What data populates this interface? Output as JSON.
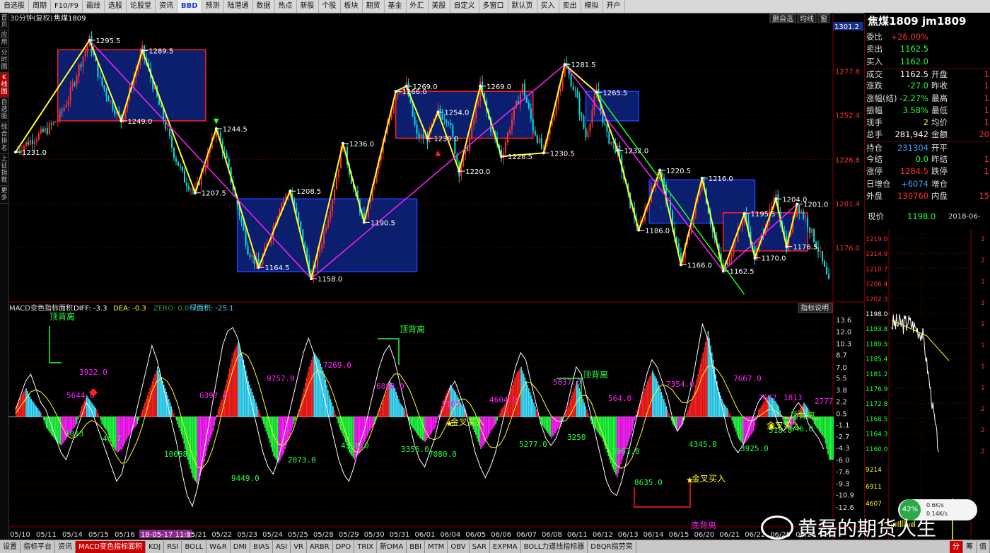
{
  "toolbar": {
    "items": [
      "自选股",
      "周期",
      "F10/F9",
      "画线",
      "选股",
      "论股堂",
      "资讯",
      "BBD",
      "预测",
      "陆港通",
      "数据",
      "热点",
      "新股",
      "个股",
      "板块",
      "期货",
      "基金",
      "外汇",
      "美股",
      "自定义",
      "多窗口",
      "默认页",
      "买入",
      "卖出",
      "模拟",
      "开户"
    ]
  },
  "leftbar": {
    "items": [
      "首页",
      "应用",
      "分时图",
      "K线图",
      "自选股",
      "综合排名",
      "上证指数",
      "更多"
    ],
    "active": 3
  },
  "chart_header": {
    "period": "30分钟(复权)",
    "name": "焦煤1809",
    "right_tabs": [
      "删自选",
      "均线",
      "窗"
    ],
    "top_price": "1301.2"
  },
  "macd_header": {
    "title": "MACD变色指标面积",
    "diff": "DIFF: -3.3",
    "dea": "DEA: -0.3",
    "zero": "ZERO: 0.0",
    "area": "绿面积: -25.1",
    "help": "指标说明"
  },
  "colors": {
    "bg": "#000000",
    "candle_up": "#ff3030",
    "candle_down": "#00e0e0",
    "box_fill": "#0b1f6e",
    "box_red": "#ff2020",
    "box_blue": "#2040ff",
    "zigzag": "#ffff20",
    "trend": "#ff20ff",
    "green_line": "#20ff20",
    "hist_red": "#ff2020",
    "hist_cyan": "#40e0ff",
    "hist_green": "#20ff40",
    "hist_magenta": "#ff20ff"
  },
  "chart_data": [
    {
      "type": "candlestick",
      "title": "焦煤1809 30分钟(复权)",
      "y_ticks": [
        "1277.8",
        "1252.4",
        "1226.8",
        "1201.4",
        "1176.0"
      ],
      "ylim": [
        1145,
        1304
      ],
      "x_labels": [
        "05/10",
        "05/11",
        "05/14",
        "05/15",
        "05/16",
        "18-05-17 11:15",
        "05/21",
        "05/22",
        "05/23",
        "05/24",
        "05/25",
        "05/28",
        "05/29",
        "05/30",
        "05/31",
        "06/01",
        "06/04",
        "06/05",
        "06/06",
        "06/07",
        "06/08",
        "06/11",
        "06/12",
        "06/13",
        "06/14",
        "06/15",
        "06/20",
        "06/21",
        "06/22",
        "06/25",
        "06/26"
      ],
      "close_path": [
        1231.0,
        1236,
        1240,
        1244,
        1250,
        1262,
        1280,
        1295.5,
        1272,
        1260,
        1249.0,
        1270,
        1289.5,
        1270,
        1250,
        1230,
        1215,
        1207.5,
        1225,
        1244.5,
        1225,
        1200,
        1175,
        1164.5,
        1180,
        1200,
        1208.5,
        1185,
        1158.0,
        1180,
        1205,
        1236.0,
        1210,
        1190.5,
        1215,
        1240,
        1266,
        1269.0,
        1240,
        1239.0,
        1254,
        1250,
        1220.0,
        1238,
        1269.0,
        1245,
        1228.5,
        1250,
        1269.0,
        1245,
        1230.5,
        1255,
        1281.5,
        1265,
        1240,
        1265.5,
        1240,
        1232.0,
        1205,
        1186.0,
        1205,
        1220.5,
        1195,
        1166.0,
        1190,
        1216.0,
        1185,
        1162.5,
        1178,
        1195.5,
        1170.0,
        1190,
        1204.0,
        1176.5,
        1201.0,
        1190,
        1175,
        1155
      ],
      "swing_labels": [
        {
          "i": 0,
          "v": 1231.0,
          "t": "1231.0"
        },
        {
          "i": 7,
          "v": 1295.5,
          "t": "1295.5"
        },
        {
          "i": 10,
          "v": 1249.0,
          "t": "1249.0"
        },
        {
          "i": 12,
          "v": 1289.5,
          "t": "1289.5"
        },
        {
          "i": 17,
          "v": 1207.5,
          "t": "1207.5"
        },
        {
          "i": 19,
          "v": 1244.5,
          "t": "1244.5"
        },
        {
          "i": 23,
          "v": 1164.5,
          "t": "1164.5"
        },
        {
          "i": 26,
          "v": 1208.5,
          "t": "1208.5"
        },
        {
          "i": 28,
          "v": 1158.0,
          "t": "1158.0"
        },
        {
          "i": 31,
          "v": 1236.0,
          "t": "1236.0"
        },
        {
          "i": 33,
          "v": 1190.5,
          "t": "1190.5"
        },
        {
          "i": 36,
          "v": 1266.0,
          "t": "1266.0"
        },
        {
          "i": 37,
          "v": 1269.0,
          "t": "1269.0"
        },
        {
          "i": 39,
          "v": 1239.0,
          "t": "1239.0"
        },
        {
          "i": 40,
          "v": 1254.0,
          "t": "1254.0"
        },
        {
          "i": 42,
          "v": 1220.0,
          "t": "1220.0"
        },
        {
          "i": 44,
          "v": 1269.0,
          "t": "1269.0"
        },
        {
          "i": 46,
          "v": 1228.5,
          "t": "1228.5"
        },
        {
          "i": 50,
          "v": 1230.5,
          "t": "1230.5"
        },
        {
          "i": 52,
          "v": 1281.5,
          "t": "1281.5"
        },
        {
          "i": 55,
          "v": 1265.5,
          "t": "1265.5"
        },
        {
          "i": 57,
          "v": 1232.0,
          "t": "1232.0"
        },
        {
          "i": 59,
          "v": 1186.0,
          "t": "1186.0"
        },
        {
          "i": 61,
          "v": 1220.5,
          "t": "1220.5"
        },
        {
          "i": 63,
          "v": 1166.0,
          "t": "1166.0"
        },
        {
          "i": 65,
          "v": 1216.0,
          "t": "1216.0"
        },
        {
          "i": 67,
          "v": 1162.5,
          "t": "1162.5"
        },
        {
          "i": 69,
          "v": 1195.5,
          "t": "1195.5"
        },
        {
          "i": 70,
          "v": 1170.0,
          "t": "1170.0"
        },
        {
          "i": 72,
          "v": 1204.0,
          "t": "1204.0"
        },
        {
          "i": 73,
          "v": 1176.5,
          "t": "1176.5"
        },
        {
          "i": 74,
          "v": 1201.0,
          "t": "1201.0"
        }
      ],
      "boxes": [
        {
          "i0": 4,
          "i1": 18,
          "top": 1290,
          "bot": 1249,
          "edge": "red"
        },
        {
          "i0": 21,
          "i1": 38,
          "top": 1204,
          "bot": 1162,
          "edge": "blue"
        },
        {
          "i0": 36,
          "i1": 49,
          "top": 1266,
          "bot": 1239,
          "edge": "red"
        },
        {
          "i0": 54,
          "i1": 59,
          "top": 1266,
          "bot": 1249,
          "edge": "blue"
        },
        {
          "i0": 60,
          "i1": 70,
          "top": 1215,
          "bot": 1190,
          "edge": "blue"
        },
        {
          "i0": 67,
          "i1": 75,
          "top": 1196,
          "bot": 1174,
          "edge": "red"
        }
      ],
      "trendlines": [
        {
          "a": [
            7,
            1295.5
          ],
          "b": [
            28,
            1158.0
          ],
          "color": "trend"
        },
        {
          "a": [
            28,
            1158.0
          ],
          "b": [
            52,
            1281.5
          ],
          "color": "trend"
        },
        {
          "a": [
            52,
            1281.5
          ],
          "b": [
            67,
            1162.5
          ],
          "color": "trend"
        },
        {
          "a": [
            67,
            1162.5
          ],
          "b": [
            74,
            1201.0
          ],
          "color": "trend"
        },
        {
          "a": [
            55,
            1265.5
          ],
          "b": [
            69,
            1149
          ],
          "color": "green_line"
        }
      ]
    },
    {
      "type": "bar",
      "title": "MACD变色指标面积",
      "y_ticks": [
        "13.6",
        "12.0",
        "10.3",
        "8.7",
        "7.0",
        "5.5",
        "3.8",
        "2.2",
        "0.5",
        "-1.1",
        "-2.7",
        "-4.3",
        "-6.0",
        "-7.6",
        "-9.3",
        "-10.9",
        "-12.6"
      ],
      "ylim": [
        -13.5,
        14.5
      ],
      "hist": [
        1.5,
        3,
        4,
        2.5,
        1.5,
        0.5,
        -1.5,
        -2.5,
        -3.5,
        -4,
        -3,
        -2,
        -1,
        1.5,
        3,
        2,
        1,
        -1,
        -2,
        -4,
        -5,
        -4.5,
        -3,
        -2,
        -1,
        1,
        3,
        5,
        7,
        5,
        3,
        1,
        -1,
        -3,
        -6,
        -8.5,
        -9.5,
        -7,
        -4,
        -2,
        1,
        3,
        6,
        9,
        10.5,
        8,
        5,
        3,
        1,
        -1,
        -3,
        -5.5,
        -6.5,
        -5,
        -3,
        -1,
        1,
        4,
        7,
        9,
        8,
        6,
        3,
        1,
        -1.5,
        -3,
        -5,
        -6,
        -5,
        -3.5,
        -2,
        -1,
        1,
        3,
        5,
        4,
        2,
        1,
        -1,
        -2,
        -3,
        -3.5,
        -2.5,
        -1.5,
        1,
        3,
        4.5,
        3.5,
        2,
        1,
        -1,
        -2.5,
        -4.5,
        -3.5,
        -2,
        -1,
        1,
        2,
        4,
        6,
        7,
        5,
        3,
        1,
        -1,
        -2,
        -3,
        -2,
        -1,
        1,
        3,
        5,
        3,
        1,
        -1,
        -2,
        -3,
        -5,
        -7,
        -8.5,
        -6,
        -4,
        -2,
        1,
        3,
        5,
        6.5,
        5,
        3,
        1,
        -1,
        -2,
        -1,
        1,
        3,
        6,
        9,
        12,
        8,
        4,
        2,
        1,
        -1,
        -3,
        -4,
        -3,
        -2,
        1,
        2,
        3,
        2.5,
        1.5,
        -1,
        -1.5,
        -1,
        1,
        2,
        1,
        -1,
        -2,
        -3,
        -6
      ],
      "diff": [
        1,
        3,
        5,
        6,
        4,
        2,
        1,
        -1,
        -3,
        -5,
        -6,
        -4,
        -2,
        0,
        2,
        1,
        -1,
        -3,
        -5,
        -7,
        -9,
        -8,
        -5,
        -2,
        1,
        4,
        7,
        10,
        8,
        5,
        2,
        -1,
        -4,
        -8,
        -11,
        -12.5,
        -10,
        -6,
        -2,
        2,
        6,
        10,
        12,
        12.5,
        11,
        8,
        4,
        1,
        -2,
        -5,
        -7,
        -8,
        -6,
        -3,
        0,
        3,
        6,
        9,
        11,
        9,
        6,
        3,
        0,
        -3,
        -6,
        -8,
        -9,
        -7,
        -4,
        -2,
        1,
        4,
        7,
        9,
        10,
        8,
        5,
        2,
        -1,
        -4,
        -6,
        -7,
        -5,
        -3,
        0,
        2,
        4,
        5,
        3,
        1,
        -2,
        -5,
        -7,
        -8.5,
        -7,
        -5,
        -2,
        1,
        4,
        7,
        9,
        8,
        5,
        2,
        -1,
        -3,
        -4,
        -3,
        -1,
        1,
        4,
        7,
        6,
        3,
        0,
        -3,
        -6,
        -9,
        -10.5,
        -11,
        -9,
        -6,
        -3,
        0,
        3,
        6,
        8,
        7,
        5,
        3,
        0,
        -2,
        -1,
        2,
        5,
        9,
        13,
        11,
        7,
        4,
        1,
        -2,
        -4,
        -5,
        -4,
        -2,
        0,
        2,
        3,
        2,
        1,
        -1,
        -2,
        -1,
        1,
        2,
        1,
        -1,
        -2,
        -3,
        -4.5
      ],
      "dea": [
        0.5,
        1.5,
        2.5,
        3.5,
        3.8,
        3.5,
        2.8,
        1.8,
        0.5,
        -1,
        -2.5,
        -3,
        -2.8,
        -2,
        -1,
        -0.5,
        -0.8,
        -1.5,
        -2.5,
        -4,
        -5.5,
        -6.5,
        -6.3,
        -5,
        -3.5,
        -1.5,
        1,
        3.5,
        5,
        5.5,
        5,
        3.8,
        2,
        -0.5,
        -3,
        -5.5,
        -7,
        -7.2,
        -6.3,
        -4.5,
        -2,
        1,
        4,
        6.5,
        8.5,
        9,
        8.5,
        7,
        5,
        2.5,
        0,
        -2.5,
        -3.8,
        -4,
        -3.2,
        -1.8,
        0.5,
        2.5,
        4.5,
        6,
        6.5,
        6,
        4.8,
        3,
        0.8,
        -1.5,
        -3.5,
        -4.8,
        -5,
        -4.3,
        -3,
        -1,
        1,
        3,
        5,
        6,
        6,
        5,
        3.8,
        2,
        0,
        -1.8,
        -3,
        -3.2,
        -2.8,
        -1.5,
        0,
        1.5,
        2.5,
        2.5,
        1.8,
        0.5,
        -1.5,
        -3.2,
        -4.2,
        -4.3,
        -3.8,
        -2.5,
        -0.5,
        1.5,
        3.5,
        4.8,
        4.8,
        4,
        3,
        1.5,
        0.2,
        -0.5,
        -0.7,
        -0.5,
        0.5,
        2,
        3,
        3,
        2,
        0,
        -2,
        -4,
        -5.8,
        -6.8,
        -7.2,
        -6.8,
        -5.8,
        -4,
        -2,
        0.5,
        2.5,
        3.8,
        4.5,
        4.3,
        3.8,
        2.8,
        2,
        2,
        2.5,
        3.8,
        5.8,
        7,
        7.2,
        6.5,
        5.5,
        4,
        2.5,
        1,
        0,
        -0.5,
        -0.5,
        0,
        0.5,
        1,
        1,
        0.5,
        0,
        -0.2,
        0,
        0.5,
        0.5,
        0,
        -0.3,
        -0.3
      ],
      "bar_labels": [
        "5644.0",
        "3922.0",
        "1013",
        "4657",
        "10088.0",
        "6397.0",
        "2073.0",
        "9449.0",
        "9757.0",
        "7269.0",
        "4348.0",
        "6888.0",
        "3356.0",
        "7080.0",
        "1165",
        "4604.0",
        "5277.0",
        "5837.0",
        "3250",
        "564.0",
        "3963.0",
        "8635.0",
        "7354.0",
        "4345.0",
        "7667.0",
        "3925.0",
        "2677",
        "1813",
        "518.0",
        "546.0",
        "2777"
      ],
      "annotations": [
        "顶背离",
        "顶背离",
        "顶背离",
        "底背离",
        "金叉买入",
        "金叉买入",
        "金叉买入",
        "顶背离"
      ]
    }
  ],
  "quote": {
    "title": "焦煤1809 jm1809",
    "rows": [
      [
        "委比",
        "+26.00%",
        "",
        ""
      ],
      [
        "卖出",
        "1162.5",
        "",
        ""
      ],
      [
        "买入",
        "1162.0",
        "",
        ""
      ],
      [
        "成交",
        "1162.5",
        "开盘",
        "1"
      ],
      [
        "涨跌",
        "-27.0",
        "昨收",
        "1"
      ],
      [
        "涨幅(结)",
        "-2.27%",
        "最高",
        "1"
      ],
      [
        "振幅",
        "3.58%",
        "最低",
        "1"
      ],
      [
        "现手",
        "2",
        "均价",
        "1"
      ],
      [
        "总手",
        "281,942",
        "金额",
        "20"
      ],
      [
        "持仓",
        "231304",
        "开平",
        ""
      ],
      [
        "今结",
        "0.0",
        "昨结",
        "1"
      ],
      [
        "涨停",
        "1284.5",
        "跌停",
        "1"
      ],
      [
        "日增仓",
        "+6074",
        "增仓",
        ""
      ],
      [
        "外盘",
        "130760",
        "内盘",
        "15"
      ]
    ],
    "now_label": "现价",
    "now_value": "1198.0",
    "now_date": "2018-06-",
    "mini_ticks": [
      "1219.0",
      "1214.9",
      "1210.7",
      "1206.4",
      "1202.3",
      "1198.0",
      "1193.8",
      "1189.5",
      "1185.4",
      "1181.2",
      "1176.9",
      "1172.8",
      "1168.5",
      "1164.3",
      "1160.0"
    ],
    "vol_ticks": [
      "9214",
      "6911",
      "4607"
    ],
    "mini_right": [
      "2",
      "2",
      "1",
      "1",
      "1",
      "1",
      "1",
      "1",
      "2",
      "2",
      "2"
    ]
  },
  "status": {
    "pct": "42%",
    "up": "0.6K/s",
    "down": "0.14K/s"
  },
  "bottombar": {
    "items": [
      "设置",
      "指标平台",
      "资讯",
      "MACD变色指标面积",
      "KDJ",
      "RSI",
      "BOLL",
      "W&R",
      "DMI",
      "BIAS",
      "ASI",
      "VR",
      "ARBR",
      "DPO",
      "TRIX",
      "新DMA",
      "BBI",
      "MTM",
      "OBV",
      "SAR",
      "EXPMA",
      "BOLL力道线指标器",
      "DBQR指劳荣"
    ],
    "active": 3,
    "tabs": [
      "分",
      "筹",
      "值"
    ]
  },
  "watermark": {
    "text": "黄磊的期货人生"
  }
}
